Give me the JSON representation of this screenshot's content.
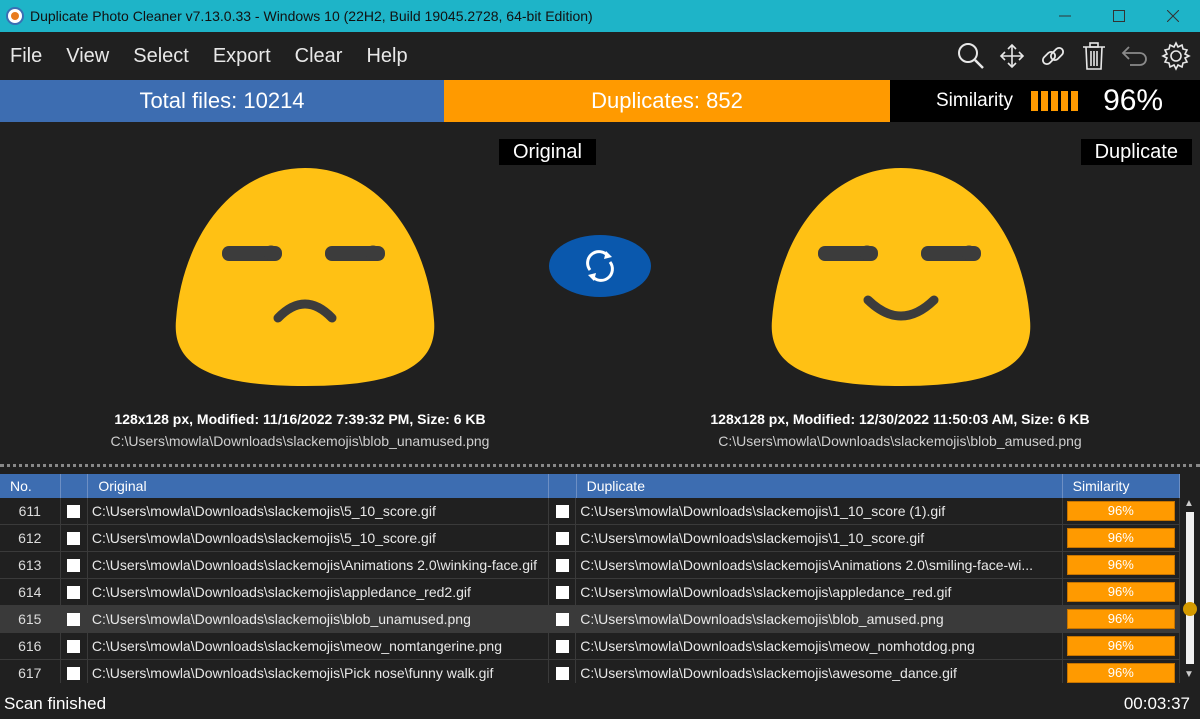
{
  "window": {
    "title": "Duplicate Photo Cleaner v7.13.0.33 - Windows 10 (22H2, Build 19045.2728, 64-bit Edition)"
  },
  "menu": [
    "File",
    "View",
    "Select",
    "Export",
    "Clear",
    "Help"
  ],
  "toolbar_icons": [
    "search-icon",
    "move-icon",
    "link-icon",
    "trash-icon",
    "undo-icon",
    "gear-icon"
  ],
  "summary": {
    "total": "Total files: 10214",
    "duplicates": "Duplicates: 852",
    "similarity_label": "Similarity",
    "similarity_value": "96%"
  },
  "preview": {
    "original_tag": "Original",
    "duplicate_tag": "Duplicate",
    "original_info": "128x128 px, Modified: 11/16/2022 7:39:32 PM, Size: 6 KB",
    "original_path": "C:\\Users\\mowla\\Downloads\\slackemojis\\blob_unamused.png",
    "duplicate_info": "128x128 px, Modified: 12/30/2022 11:50:03 AM, Size: 6 KB",
    "duplicate_path": "C:\\Users\\mowla\\Downloads\\slackemojis\\blob_amused.png"
  },
  "table": {
    "headers": {
      "no": "No.",
      "original": "Original",
      "duplicate": "Duplicate",
      "similarity": "Similarity"
    },
    "rows": [
      {
        "no": "611",
        "original": "C:\\Users\\mowla\\Downloads\\slackemojis\\5_10_score.gif",
        "duplicate": "C:\\Users\\mowla\\Downloads\\slackemojis\\1_10_score (1).gif",
        "similarity": "96%"
      },
      {
        "no": "612",
        "original": "C:\\Users\\mowla\\Downloads\\slackemojis\\5_10_score.gif",
        "duplicate": "C:\\Users\\mowla\\Downloads\\slackemojis\\1_10_score.gif",
        "similarity": "96%"
      },
      {
        "no": "613",
        "original": "C:\\Users\\mowla\\Downloads\\slackemojis\\Animations 2.0\\winking-face.gif",
        "duplicate": "C:\\Users\\mowla\\Downloads\\slackemojis\\Animations 2.0\\smiling-face-wi...",
        "similarity": "96%"
      },
      {
        "no": "614",
        "original": "C:\\Users\\mowla\\Downloads\\slackemojis\\appledance_red2.gif",
        "duplicate": "C:\\Users\\mowla\\Downloads\\slackemojis\\appledance_red.gif",
        "similarity": "96%"
      },
      {
        "no": "615",
        "original": "C:\\Users\\mowla\\Downloads\\slackemojis\\blob_unamused.png",
        "duplicate": "C:\\Users\\mowla\\Downloads\\slackemojis\\blob_amused.png",
        "similarity": "96%"
      },
      {
        "no": "616",
        "original": "C:\\Users\\mowla\\Downloads\\slackemojis\\meow_nomtangerine.png",
        "duplicate": "C:\\Users\\mowla\\Downloads\\slackemojis\\meow_nomhotdog.png",
        "similarity": "96%"
      },
      {
        "no": "617",
        "original": "C:\\Users\\mowla\\Downloads\\slackemojis\\Pick nose\\funny walk.gif",
        "duplicate": "C:\\Users\\mowla\\Downloads\\slackemojis\\awesome_dance.gif",
        "similarity": "96%"
      }
    ],
    "selected_row": 4
  },
  "status": {
    "left": "Scan finished",
    "right": "00:03:37"
  },
  "colors": {
    "titlebar": "#1eb4c8",
    "accent_blue": "#3d6db1",
    "accent_orange": "#ff9a00",
    "swap_blue": "#0a58ad"
  }
}
